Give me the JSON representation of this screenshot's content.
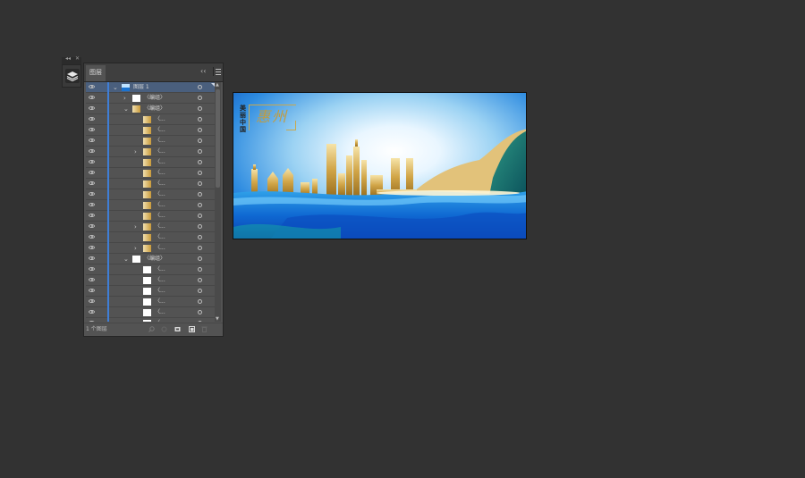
{
  "strip": {
    "icons": [
      "collapse-icon",
      "close-icon"
    ],
    "button_icon": "layers-icon"
  },
  "panel": {
    "tab_label": "图层",
    "footer_count": "1 个图层",
    "rows": [
      {
        "name": "图层 1",
        "chev": "⌄",
        "thumb": "mini",
        "selected": true
      },
      {
        "name": "〈编组〉",
        "chev": "›",
        "thumb": "white"
      },
      {
        "name": "〈编组〉",
        "chev": "⌄",
        "thumb": "gold"
      },
      {
        "name": "〈...",
        "chev": "",
        "thumb": "gold"
      },
      {
        "name": "〈...",
        "chev": "",
        "thumb": "gold"
      },
      {
        "name": "〈...",
        "chev": "",
        "thumb": "gold"
      },
      {
        "name": "〈...",
        "chev": "›",
        "thumb": "gold"
      },
      {
        "name": "〈...",
        "chev": "",
        "thumb": "gold"
      },
      {
        "name": "〈...",
        "chev": "",
        "thumb": "gold"
      },
      {
        "name": "〈...",
        "chev": "",
        "thumb": "gold"
      },
      {
        "name": "〈...",
        "chev": "",
        "thumb": "gold"
      },
      {
        "name": "〈...",
        "chev": "",
        "thumb": "gold"
      },
      {
        "name": "〈...",
        "chev": "",
        "thumb": "gold"
      },
      {
        "name": "〈...",
        "chev": "›",
        "thumb": "gold"
      },
      {
        "name": "〈...",
        "chev": "",
        "thumb": "gold"
      },
      {
        "name": "〈...",
        "chev": "›",
        "thumb": "gold"
      },
      {
        "name": "〈编组〉",
        "chev": "⌄",
        "thumb": "white"
      },
      {
        "name": "〈...",
        "chev": "",
        "thumb": "white"
      },
      {
        "name": "〈...",
        "chev": "",
        "thumb": "white"
      },
      {
        "name": "〈...",
        "chev": "",
        "thumb": "white"
      },
      {
        "name": "〈...",
        "chev": "",
        "thumb": "white"
      },
      {
        "name": "〈...",
        "chev": "",
        "thumb": "white"
      },
      {
        "name": "〈...",
        "chev": "",
        "thumb": "white"
      }
    ]
  },
  "artwork": {
    "vertical_text": "美丽中国",
    "city_title": "惠州",
    "colors": {
      "gold": "#c9a84e",
      "sea": "#1a73d0",
      "sky": "#9bd2f3",
      "hill": "#0f6f5e"
    }
  }
}
